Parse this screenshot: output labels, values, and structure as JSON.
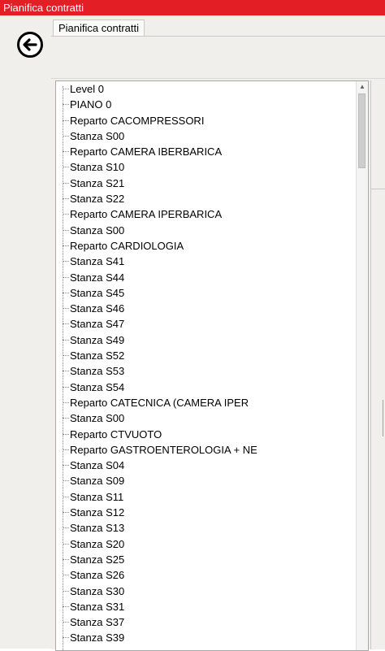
{
  "window": {
    "title": "Pianifica contratti",
    "accent_color": "#e31e24"
  },
  "navigation": {
    "back_icon": "arrow-left-circle-icon"
  },
  "tabs": [
    {
      "label": "Pianifica contratti",
      "selected": true
    }
  ],
  "tree": {
    "items": [
      "Level 0",
      "PIANO 0",
      "Reparto CACOMPRESSORI",
      "Stanza S00",
      "Reparto CAMERA IBERBARICA",
      "Stanza S10",
      "Stanza S21",
      "Stanza S22",
      "Reparto CAMERA IPERBARICA",
      "Stanza S00",
      "Reparto CARDIOLOGIA",
      "Stanza S41",
      "Stanza S44",
      "Stanza S45",
      "Stanza S46",
      "Stanza S47",
      "Stanza S49",
      "Stanza S52",
      "Stanza S53",
      "Stanza S54",
      "Reparto CATECNICA (CAMERA IPER",
      "Stanza S00",
      "Reparto CTVUOTO",
      "Reparto GASTROENTEROLOGIA + NE",
      "Stanza S04",
      "Stanza S09",
      "Stanza S11",
      "Stanza S12",
      "Stanza S13",
      "Stanza S20",
      "Stanza S25",
      "Stanza S26",
      "Stanza S30",
      "Stanza S31",
      "Stanza S37",
      "Stanza S39"
    ]
  }
}
